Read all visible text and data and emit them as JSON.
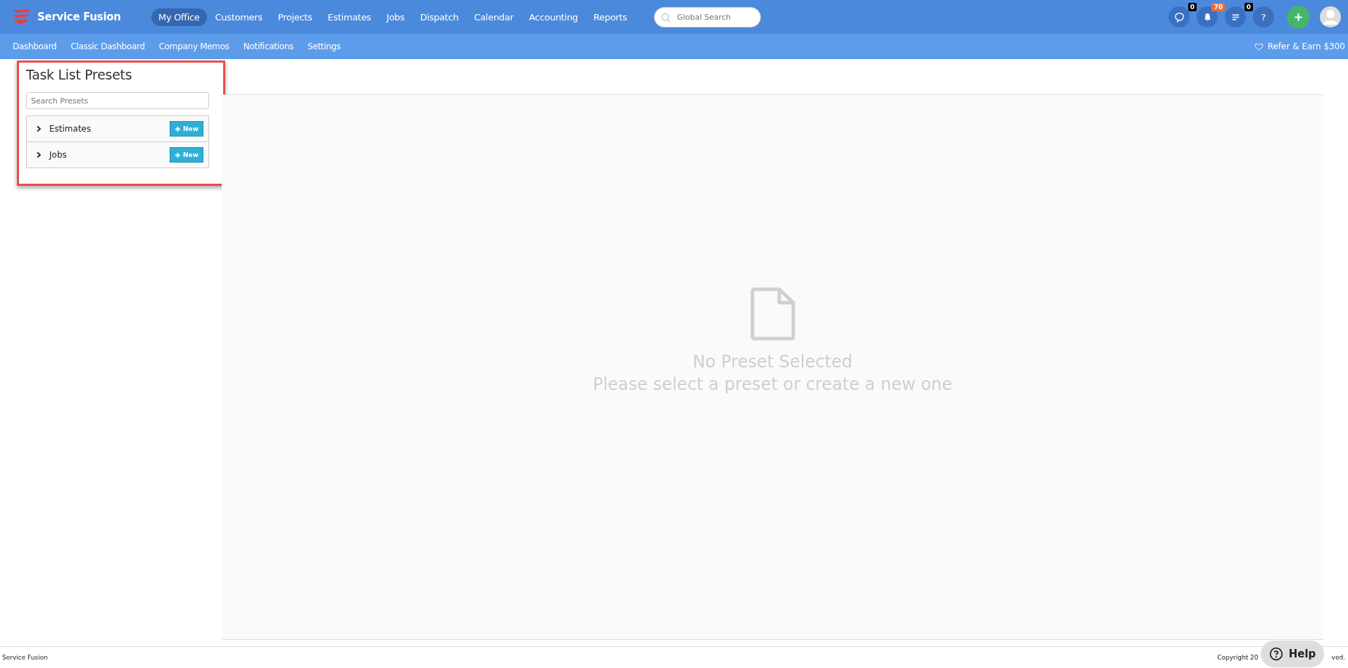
{
  "brand": {
    "name": "Service Fusion"
  },
  "nav": [
    {
      "label": "My Office",
      "selected": true
    },
    {
      "label": "Customers",
      "selected": false
    },
    {
      "label": "Projects",
      "selected": false
    },
    {
      "label": "Estimates",
      "selected": false
    },
    {
      "label": "Jobs",
      "selected": false
    },
    {
      "label": "Dispatch",
      "selected": false
    },
    {
      "label": "Calendar",
      "selected": false
    },
    {
      "label": "Accounting",
      "selected": false
    },
    {
      "label": "Reports",
      "selected": false
    }
  ],
  "search": {
    "placeholder": "Global Search"
  },
  "toolbar": [
    {
      "kind": "chat",
      "badge": "0",
      "color": "#000000"
    },
    {
      "kind": "bell",
      "badge": "70",
      "color": "#f26b3a"
    },
    {
      "kind": "list",
      "badge": "0",
      "color": "#000000"
    },
    {
      "kind": "help",
      "label": "?"
    }
  ],
  "subnav": [
    "Dashboard",
    "Classic Dashboard",
    "Company Memos",
    "Notifications",
    "Settings"
  ],
  "refer": {
    "label": "Refer & Earn $300"
  },
  "panel": {
    "title": "Task List Presets",
    "search": {
      "placeholder": "Search Presets"
    },
    "groups": [
      {
        "label": "Estimates",
        "expanded": false,
        "button": "New"
      },
      {
        "label": "Jobs",
        "expanded": false,
        "button": "New"
      }
    ]
  },
  "empty": {
    "title": "No Preset Selected",
    "message": "Please select a preset or create a new one"
  },
  "footer": {
    "left": "Service Fusion",
    "right_start": "Copyright 20",
    "right_end": "ved."
  },
  "help_button": {
    "label": "Help"
  }
}
